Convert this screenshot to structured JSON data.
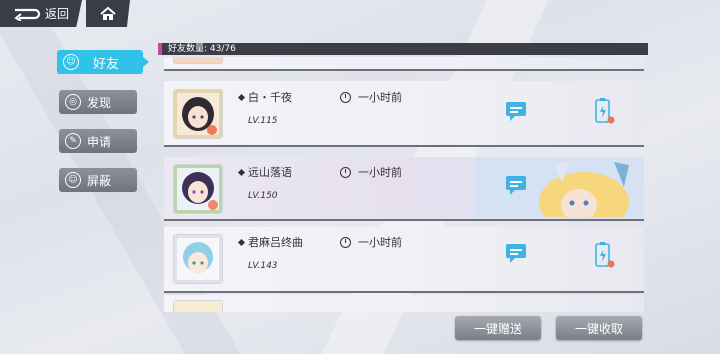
{
  "topbar": {
    "back_label": "返回",
    "back_icon": "back-arrow-icon",
    "home_icon": "home-icon"
  },
  "sidebar": {
    "items": [
      {
        "label": "好友",
        "icon": "friends-icon",
        "active": true
      },
      {
        "label": "发现",
        "icon": "discover-icon",
        "active": false
      },
      {
        "label": "申请",
        "icon": "pencil-icon",
        "active": false
      },
      {
        "label": "屏蔽",
        "icon": "block-user-icon",
        "active": false
      }
    ]
  },
  "friend_count": {
    "label": "好友数量",
    "value": "43/76"
  },
  "friends": [
    {
      "name": "白・千夜",
      "level": "LV.115",
      "time": "一小时前",
      "send_icon": "chat-gift-icon",
      "receive_icon": "stamina-battery-icon"
    },
    {
      "name": "远山落语",
      "level": "LV.150",
      "time": "一小时前",
      "send_icon": "chat-gift-icon",
      "receive_icon": ""
    },
    {
      "name": "君麻吕终曲",
      "level": "LV.143",
      "time": "一小时前",
      "send_icon": "chat-gift-icon",
      "receive_icon": "stamina-battery-icon"
    }
  ],
  "actions": {
    "send_all": "一键赠送",
    "receive_all": "一键收取"
  },
  "colors": {
    "accent": "#30c2e8",
    "bar": "#3b3e46",
    "count_marker": "#c44aa5"
  }
}
